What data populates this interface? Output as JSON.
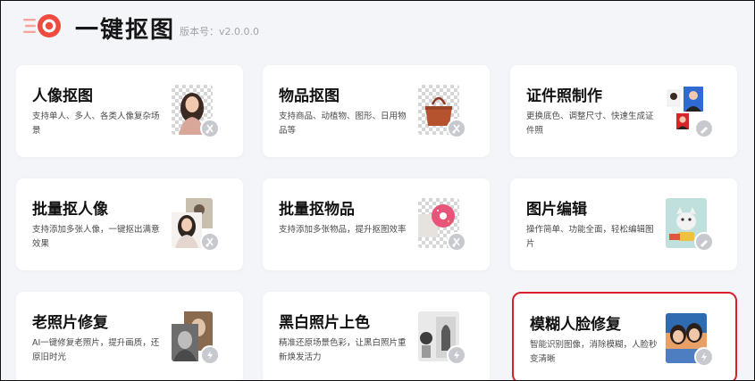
{
  "header": {
    "brand": "一键抠图",
    "version": "版本号：v2.0.0.0"
  },
  "cards": [
    {
      "title": "人像抠图",
      "desc": "支持单人、多人、各类人像复杂场景"
    },
    {
      "title": "物品抠图",
      "desc": "支持商品、动植物、图形、日用物品等"
    },
    {
      "title": "证件照制作",
      "desc": "更换底色、调整尺寸、快速生成证件照"
    },
    {
      "title": "批量抠人像",
      "desc": "支持添加多张人像，一键抠出满意效果"
    },
    {
      "title": "批量抠物品",
      "desc": "支持添加多张物品，提升抠图效率"
    },
    {
      "title": "图片编辑",
      "desc": "操作简单、功能全面，轻松编辑图片"
    },
    {
      "title": "老照片修复",
      "desc": "AI一键修复老照片，提升画质，还原旧时光"
    },
    {
      "title": "黑白照片上色",
      "desc": "精准还原场景色彩，让黑白照片重新焕发活力"
    },
    {
      "title": "模糊人脸修复",
      "desc": "智能识别图像，消除模糊，人脸秒变清晰"
    }
  ],
  "selected_card": "模糊人脸修复",
  "colors": {
    "brand_red": "#ef4b3f",
    "selection": "#d8212a"
  }
}
